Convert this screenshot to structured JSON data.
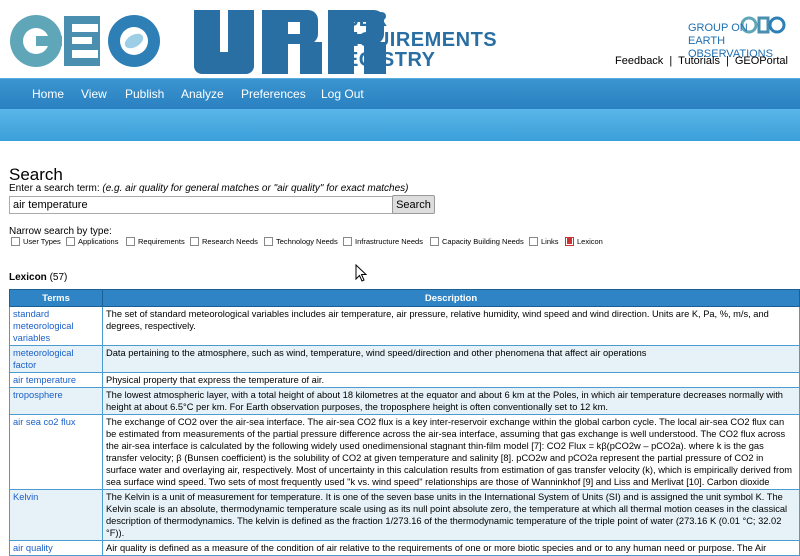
{
  "header": {
    "geo_logo": "GEO",
    "urr_logo": "URR",
    "urr_title_lines": [
      "USER",
      "REQUIREMENTS",
      "REGISTRY"
    ],
    "org_lines": [
      "GROUP ON",
      "EARTH OBSERVATIONS"
    ],
    "top_links": [
      "Feedback",
      "Tutorials",
      "GEOPortal"
    ]
  },
  "nav": {
    "items": [
      "Home",
      "View",
      "Publish",
      "Analyze",
      "Preferences",
      "Log Out"
    ]
  },
  "search": {
    "title": "Search",
    "hint_prefix": "Enter a search term:",
    "hint_body": "(e.g. air quality for general matches or \"air quality\" for exact matches)",
    "value": "air temperature",
    "button": "Search",
    "narrow_label": "Narrow search by type:",
    "types": [
      {
        "label": "User Types",
        "checked": false
      },
      {
        "label": "Applications",
        "checked": false
      },
      {
        "label": "Requirements",
        "checked": false
      },
      {
        "label": "Research Needs",
        "checked": false
      },
      {
        "label": "Technology Needs",
        "checked": false
      },
      {
        "label": "Infrastructure Needs",
        "checked": false
      },
      {
        "label": "Capacity Building Needs",
        "checked": false
      },
      {
        "label": "Links",
        "checked": false
      },
      {
        "label": "Lexicon",
        "checked": true
      }
    ]
  },
  "lexicon": {
    "title": "Lexicon",
    "count": "(57)",
    "headers": [
      "Terms",
      "Description"
    ],
    "rows": [
      {
        "term": "standard meteorological variables",
        "description": "The set of standard meteorological variables includes air temperature, air pressure, relative humidity, wind speed and wind direction. Units are K, Pa, %, m/s, and degrees, respectively."
      },
      {
        "term": "meteorological factor",
        "description": "Data pertaining to the atmosphere, such as wind, temperature, wind speed/direction and other phenomena that affect air operations"
      },
      {
        "term": "air temperature",
        "description": "Physical property that express the temperature of air."
      },
      {
        "term": "troposphere",
        "description": "The lowest atmospheric layer, with a total height of about 18 kilometres at the equator and about 6 km at the Poles, in which air temperature decreases normally with height at about 6.5°C per km. For Earth observation purposes, the troposphere height is often conventionally set to 12 km."
      },
      {
        "term": "air sea co2 flux",
        "description": "The exchange of CO2 over the air-sea interface. The air-sea CO2 flux is a key inter-reservoir exchange within the global carbon cycle. The local air-sea CO2 flux can be estimated from measurements of the partial pressure difference across the air-sea interface, assuming that gas exchange is well understood. The CO2 flux across the air-sea interface is calculated by the following widely used onedimensional stagnant thin-film model [7]: CO2 Flux = kβ(pCO2w – pCO2a). where k is the gas transfer velocity; β (Bunsen coefficient) is the solubility of CO2 at given temperature and salinity [8]. pCO2w and pCO2a represent the partial pressure of CO2 in surface water and overlaying air, respectively. Most of uncertainty in this calculation results from estimation of gas transfer velocity (k), which is empirically derived from sea surface wind speed. Two sets of most frequently used \"k vs. wind speed\" relationships are those of Wanninkhof [9] and Liss and Merlivat [10]. Carbon dioxide"
      },
      {
        "term": "Kelvin",
        "description": "The Kelvin is a unit of measurement for temperature. It is one of the seven base units in the International System of Units (SI) and is assigned the unit symbol K. The Kelvin scale is an absolute, thermodynamic temperature scale using as its null point absolute zero, the temperature at which all thermal motion ceases in the classical description of thermodynamics. The kelvin is defined as the fraction 1/273.16 of the thermodynamic temperature of the triple point of water (273.16 K (0.01 °C; 32.02 °F))."
      },
      {
        "term": "air quality",
        "description": "Air quality is defined as a measure of the condition of air relative to the requirements of one or more biotic species and or to any human need or purpose. The Air"
      }
    ]
  }
}
